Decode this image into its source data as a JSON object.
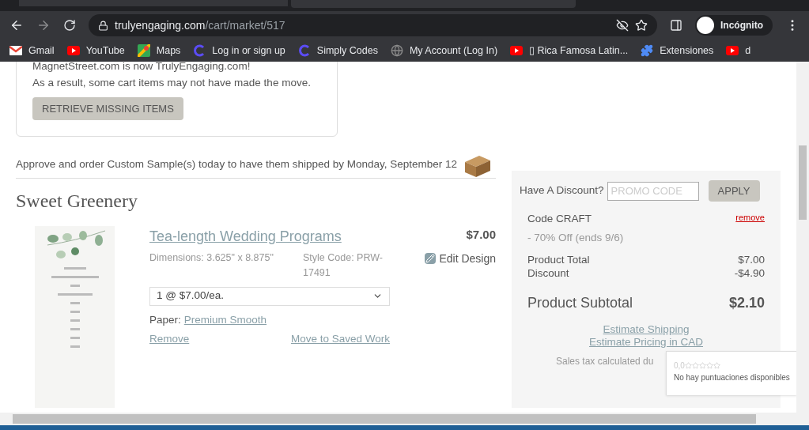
{
  "browser": {
    "url_host": "trulyengaging.com",
    "url_path": "/cart/market/517",
    "profile": "Incógnito",
    "bookmarks": [
      {
        "label": "Gmail",
        "kind": "gmail"
      },
      {
        "label": "YouTube",
        "kind": "youtube"
      },
      {
        "label": "Maps",
        "kind": "maps"
      },
      {
        "label": "Log in or sign up",
        "kind": "ring"
      },
      {
        "label": "Simply Codes",
        "kind": "ring"
      },
      {
        "label": "My Account (Log In)",
        "kind": "globe"
      },
      {
        "label": "▯ Rica Famosa Latin...",
        "kind": "youtube"
      },
      {
        "label": "Extensiones",
        "kind": "puzzle"
      },
      {
        "label": "d",
        "kind": "youtube"
      }
    ]
  },
  "notice": {
    "lines": [
      "MagnetStreet.com is now TrulyEngaging.com!",
      "As a result, some cart items may not have made the move."
    ],
    "button": "RETRIEVE MISSING ITEMS"
  },
  "shipping_note": "Approve and order Custom Sample(s) today to have them shipped by Monday, September 12",
  "section_title": "Sweet Greenery",
  "item": {
    "name": "Tea-length Wedding Programs",
    "dimensions": "Dimensions: 3.625\" x 8.875\"",
    "style_code": "Style Code: PRW-17491",
    "quantity": "1 @ $7.00/ea.",
    "paper_label": "Paper:",
    "paper": "Premium Smooth",
    "remove": "Remove",
    "move": "Move to Saved Work",
    "price": "$7.00",
    "edit": "Edit Design"
  },
  "summary": {
    "discount_label": "Have A Discount?",
    "promo_placeholder": "PROMO CODE",
    "apply": "APPLY",
    "code": "Code CRAFT",
    "code_remove": "remove",
    "code_detail": "- 70% Off (ends 9/6)",
    "rows": [
      {
        "label": "Product Total",
        "value": "$7.00"
      },
      {
        "label": "Discount",
        "value": "-$4.90"
      }
    ],
    "subtotal_label": "Product Subtotal",
    "subtotal": "$2.10",
    "links": [
      "Estimate Shipping",
      "Estimate Pricing in CAD"
    ],
    "tax_note": "Sales tax calculated du"
  },
  "rating": {
    "score": "0,0",
    "stars": 0,
    "text": "No hay puntuaciones disponibles"
  }
}
